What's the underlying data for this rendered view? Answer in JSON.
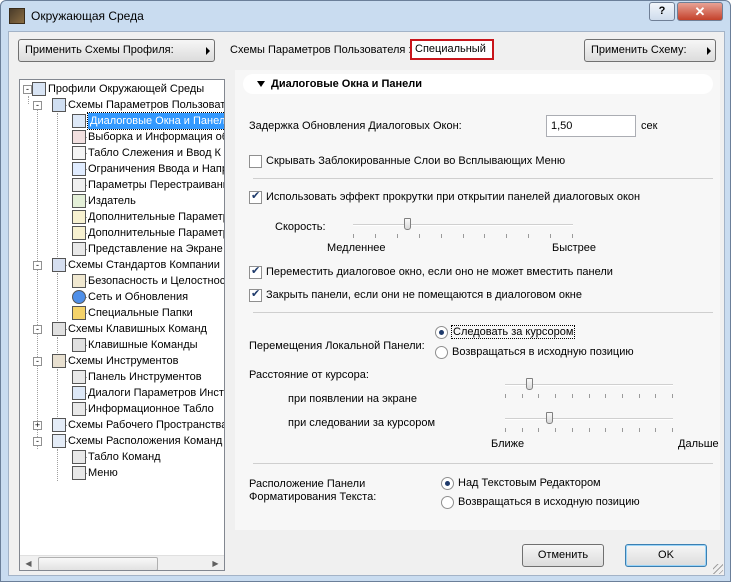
{
  "window": {
    "title": "Окружающая Среда",
    "help_label": "?",
    "close_label": "✕"
  },
  "toolbar": {
    "apply_profile_label": "Применить Схемы Профиля:",
    "user_schemes_label": "Схемы Параметров Пользователя :",
    "user_schemes_value": "Специальный",
    "apply_scheme_label": "Применить Схему:"
  },
  "tree": {
    "items": [
      {
        "label": "Профили Окружающей Среды",
        "icon": "profiles-icon"
      },
      {
        "label": "Схемы Параметров Пользоват",
        "icon": "user-schemes-icon"
      },
      {
        "label": "Диалоговые Окна и Панел",
        "icon": "dialog-boxes-icon"
      },
      {
        "label": "Выборка и Информация об",
        "icon": "selection-info-icon"
      },
      {
        "label": "Табло Слежения и Ввод К",
        "icon": "tracker-icon"
      },
      {
        "label": "Ограничения Ввода и Напр",
        "icon": "constraints-icon"
      },
      {
        "label": "Параметры Перестраивани",
        "icon": "rebuild-icon"
      },
      {
        "label": "Издатель",
        "icon": "publisher-icon"
      },
      {
        "label": "Дополнительные Параметр",
        "icon": "more-options-icon"
      },
      {
        "label": "Дополнительные Параметр",
        "icon": "more-options-2-icon"
      },
      {
        "label": "Представление на Экране",
        "icon": "display-icon"
      },
      {
        "label": "Схемы Стандартов Компании",
        "icon": "company-standards-icon"
      },
      {
        "label": "Безопасность и Целостнос",
        "icon": "safety-icon"
      },
      {
        "label": "Сеть и Обновления",
        "icon": "network-icon"
      },
      {
        "label": "Специальные Папки",
        "icon": "folder-icon"
      },
      {
        "label": "Схемы Клавишных Команд",
        "icon": "shortcut-schemes-icon"
      },
      {
        "label": "Клавишные Команды",
        "icon": "keyboard-icon"
      },
      {
        "label": "Схемы Инструментов",
        "icon": "tool-schemes-icon"
      },
      {
        "label": "Панель Инструментов",
        "icon": "toolbox-icon"
      },
      {
        "label": "Диалоги Параметров Инстр",
        "icon": "tool-settings-icon"
      },
      {
        "label": "Информационное Табло",
        "icon": "info-box-icon"
      },
      {
        "label": "Схемы Рабочего Пространства",
        "icon": "workspace-icon"
      },
      {
        "label": "Схемы Расположения Команд",
        "icon": "command-layout-icon"
      },
      {
        "label": "Табло Команд",
        "icon": "command-board-icon"
      },
      {
        "label": "Меню",
        "icon": "menu-icon"
      }
    ],
    "scroll_left": "◀",
    "scroll_right": "▶"
  },
  "panel": {
    "section_title": "Диалоговые Окна и Панели",
    "delay_label": "Задержка Обновления Диалоговых Окон:",
    "delay_value": "1,50",
    "delay_unit": "сек",
    "hide_locked_label": "Скрывать Заблокированные Слои во Всплывающих Меню",
    "hide_locked_checked": false,
    "scroll_effect_label": "Использовать эффект прокрутки при открытии панелей диалоговых окон",
    "scroll_effect_checked": true,
    "speed_label": "Скорость:",
    "speed_slow": "Медленнее",
    "speed_fast": "Быстрее",
    "speed_level": 0.25,
    "move_dialog_label": "Переместить диалоговое окно, если оно не может вместить панели",
    "move_dialog_checked": true,
    "close_panels_label": "Закрыть панели, если они не помещаются в диалоговом окне",
    "close_panels_checked": true,
    "local_panel_label": "Перемещения Локальной Панели:",
    "follow_cursor_label": "Следовать за курсором",
    "return_position_label": "Возвращаться в исходную позицию",
    "local_panel_selected": "follow",
    "distance_label": "Расстояние от курсора:",
    "on_appear_label": "при появлении на экране",
    "on_follow_label": "при следовании за курсором",
    "near_label": "Ближе",
    "far_label": "Дальше",
    "on_appear_level": 0.15,
    "on_follow_level": 0.27,
    "format_panel_label_1": "Расположение Панели",
    "format_panel_label_2": "Форматирования Текста:",
    "above_editor_label": "Над Текстовым Редактором",
    "format_return_label": "Возвращаться в исходную позицию",
    "format_panel_selected": "above"
  },
  "footer": {
    "cancel_label": "Отменить",
    "ok_label": "OK"
  }
}
